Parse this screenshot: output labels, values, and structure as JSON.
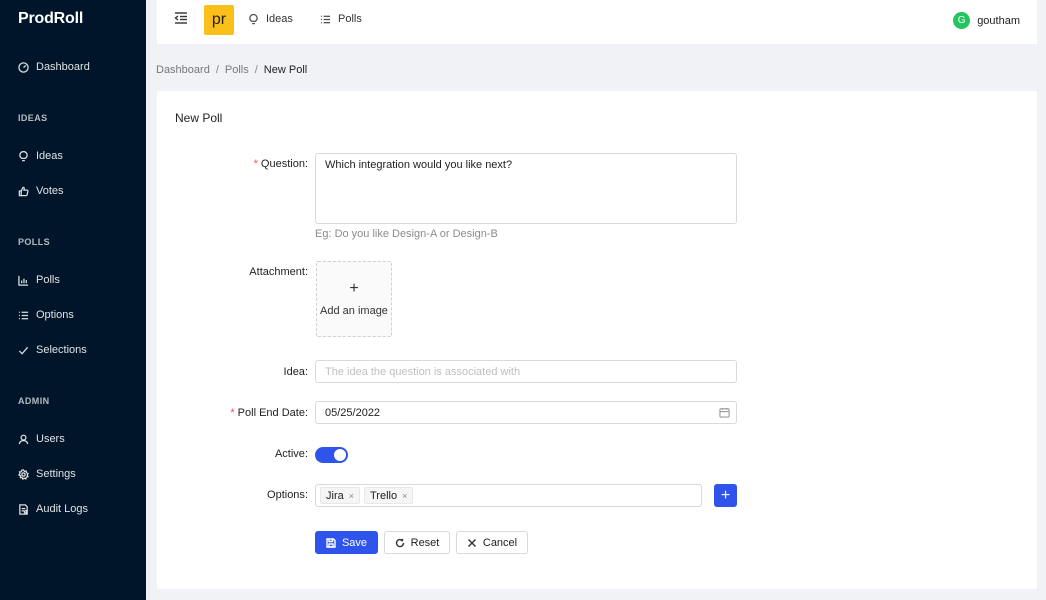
{
  "brand": "ProdRoll",
  "sidebar": {
    "dashboard": "Dashboard",
    "groups": {
      "ideas": "IDEAS",
      "polls": "POLLS",
      "admin": "ADMIN"
    },
    "items": {
      "ideas": "Ideas",
      "votes": "Votes",
      "polls": "Polls",
      "options": "Options",
      "selections": "Selections",
      "users": "Users",
      "settings": "Settings",
      "audit_logs": "Audit Logs"
    }
  },
  "header": {
    "logo_text": "pr",
    "nav": {
      "ideas": "Ideas",
      "polls": "Polls"
    },
    "user": {
      "initial": "G",
      "name": "goutham",
      "avatar_color": "#22c55e"
    }
  },
  "breadcrumb": {
    "items": [
      "Dashboard",
      "Polls",
      "New Poll"
    ],
    "separator": "/"
  },
  "form": {
    "title": "New Poll",
    "required_mark": "*",
    "question": {
      "label": "Question",
      "value": "Which integration would you like next?",
      "help": "Eg: Do you like Design-A or Design-B"
    },
    "attachment": {
      "label": "Attachment",
      "upload_plus": "+",
      "upload_label": "Add an image"
    },
    "idea": {
      "label": "Idea",
      "placeholder": "The idea the question is associated with",
      "value": ""
    },
    "poll_end_date": {
      "label": "Poll End Date",
      "value": "05/25/2022"
    },
    "active": {
      "label": "Active",
      "checked": true
    },
    "options": {
      "label": "Options",
      "tags": [
        "Jira",
        "Trello"
      ],
      "remove_glyph": "×",
      "add_glyph": "+"
    },
    "actions": {
      "save": "Save",
      "reset": "Reset",
      "cancel": "Cancel"
    }
  },
  "colors": {
    "primary": "#2f54eb",
    "sidebar_bg": "#001529",
    "logo_bg": "#fbbf1a",
    "required": "#ff4d4f"
  }
}
